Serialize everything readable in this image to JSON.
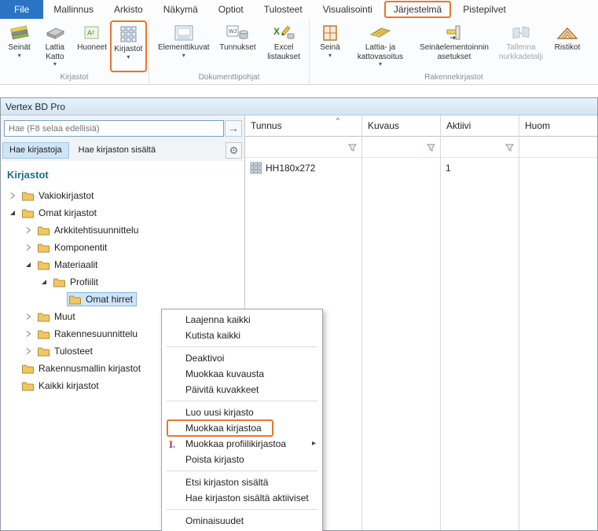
{
  "colors": {
    "annotation_orange": "#E8772A",
    "file_tab_blue": "#2B74C4",
    "tree_selection_blue": "#CFE5FB",
    "tree_heading_teal": "#17708F"
  },
  "glyphs": {
    "dropdown": "▾",
    "submenu": "▸",
    "sort_asc": "^",
    "go_arrow": "→",
    "gear": "⚙"
  },
  "ribbon": {
    "tabs": [
      {
        "label": "File"
      },
      {
        "label": "Mallinnus"
      },
      {
        "label": "Arkisto"
      },
      {
        "label": "Näkymä"
      },
      {
        "label": "Optiot"
      },
      {
        "label": "Tulosteet"
      },
      {
        "label": "Visualisointi"
      },
      {
        "label": "Järjestelmä"
      },
      {
        "label": "Pistepilvet"
      }
    ],
    "groups": [
      {
        "label": "Kirjastot",
        "buttons": [
          {
            "label": "Seinät"
          },
          {
            "label": "Lattia Katto"
          },
          {
            "label": "Huoneet"
          },
          {
            "label": "Kirjastot"
          }
        ]
      },
      {
        "label": "Dokumenttipohjat",
        "buttons": [
          {
            "label": "Elementtikuvat"
          },
          {
            "label": "Tunnukset"
          },
          {
            "label": "Excel listaukset"
          }
        ]
      },
      {
        "label": "Rakennekirjastot",
        "buttons": [
          {
            "label": "Seinä"
          },
          {
            "label": "Lattia- ja kattovasoitus"
          },
          {
            "label": "Seinäelementoinnin asetukset"
          },
          {
            "label": "Tallenna nurkkadetalji"
          },
          {
            "label": "Ristikot"
          }
        ]
      }
    ]
  },
  "window": {
    "title": "Vertex BD Pro"
  },
  "left_panel": {
    "search_placeholder": "Hae (F8 selaa edellisiä)",
    "tabs": [
      {
        "label": "Hae kirjastoja",
        "active": true
      },
      {
        "label": "Hae kirjaston sisältä",
        "active": false
      }
    ],
    "tree": {
      "heading": "Kirjastot",
      "items": [
        {
          "label": "Vakiokirjastot",
          "indent": 1,
          "state": "collapsed"
        },
        {
          "label": "Omat kirjastot",
          "indent": 1,
          "state": "expanded"
        },
        {
          "label": "Arkkitehtisuunnittelu",
          "indent": 2,
          "state": "collapsed"
        },
        {
          "label": "Komponentit",
          "indent": 2,
          "state": "collapsed"
        },
        {
          "label": "Materiaalit",
          "indent": 2,
          "state": "expanded"
        },
        {
          "label": "Profiilit",
          "indent": 3,
          "state": "expanded"
        },
        {
          "label": "Omat hirret",
          "indent": 4,
          "state": "leaf",
          "selected": true
        },
        {
          "label": "Muut",
          "indent": 2,
          "state": "collapsed"
        },
        {
          "label": "Rakennesuunnittelu",
          "indent": 2,
          "state": "collapsed"
        },
        {
          "label": "Tulosteet",
          "indent": 2,
          "state": "collapsed"
        },
        {
          "label": "Rakennusmallin kirjastot",
          "indent": 1,
          "state": "leaf"
        },
        {
          "label": "Kaikki kirjastot",
          "indent": 1,
          "state": "leaf"
        }
      ]
    }
  },
  "table": {
    "columns": [
      "Tunnus",
      "Kuvaus",
      "Aktiivi",
      "Huom"
    ],
    "sorted_column": "Tunnus",
    "rows": [
      {
        "tunnus": "HH180x272",
        "kuvaus": "",
        "aktiivi": "1",
        "huom": ""
      }
    ]
  },
  "context_menu": {
    "items": [
      {
        "label": "Laajenna kaikki"
      },
      {
        "label": "Kutista kaikki"
      },
      {
        "label": "Deaktivoi"
      },
      {
        "label": "Muokkaa kuvausta"
      },
      {
        "label": "Päivitä kuvakkeet"
      },
      {
        "label": "Luo uusi kirjasto"
      },
      {
        "label": "Muokkaa kirjastoa",
        "annotated": true
      },
      {
        "label": "Muokkaa profiilikirjastoa",
        "submenu": true
      },
      {
        "label": "Poista kirjasto"
      },
      {
        "label": "Etsi kirjaston sisältä"
      },
      {
        "label": "Hae kirjaston sisältä aktiiviset"
      },
      {
        "label": "Ominaisuudet"
      }
    ]
  }
}
